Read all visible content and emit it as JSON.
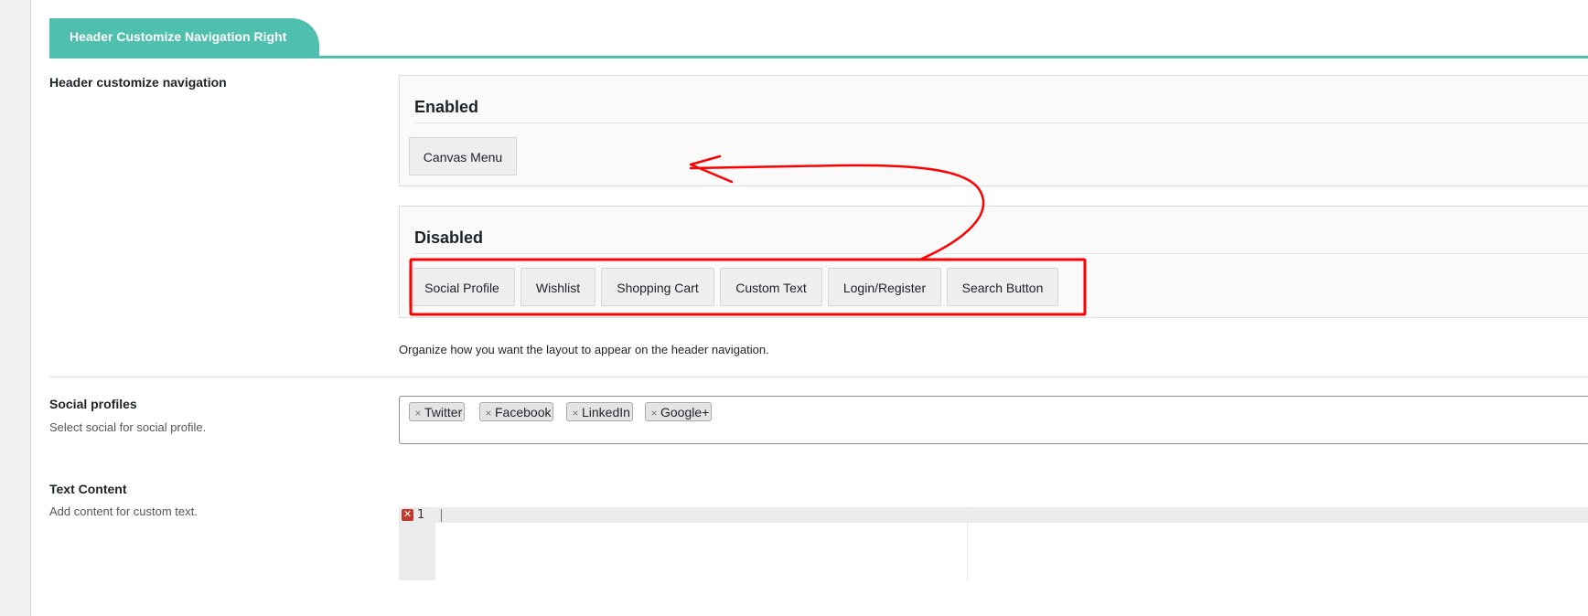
{
  "tab": {
    "label": "Header Customize Navigation Right"
  },
  "header_nav": {
    "label": "Header customize navigation",
    "enabled": {
      "title": "Enabled",
      "items": [
        "Canvas Menu"
      ]
    },
    "disabled": {
      "title": "Disabled",
      "items": [
        "Social Profile",
        "Wishlist",
        "Shopping Cart",
        "Custom Text",
        "Login/Register",
        "Search Button"
      ]
    },
    "description": "Organize how you want the layout to appear on the header navigation."
  },
  "social_profiles": {
    "label": "Social profiles",
    "description": "Select social for social profile.",
    "tokens": [
      "Twitter",
      "Facebook",
      "LinkedIn",
      "Google+"
    ],
    "remove_glyph": "×"
  },
  "text_content": {
    "label": "Text Content",
    "description": "Add content for custom text.",
    "editor": {
      "line_number": "1",
      "error_glyph": "✕"
    }
  },
  "annotation": {
    "color": "#ff0000"
  },
  "colors": {
    "accent": "#4fc0ad"
  }
}
